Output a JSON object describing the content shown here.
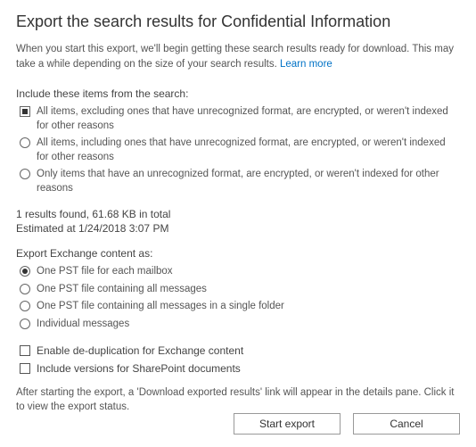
{
  "title": "Export the search results for Confidential Information",
  "intro_text": "When you start this export, we'll begin getting these search results ready for download. This may take a while depending on the size of your search results. ",
  "learn_more": "Learn more",
  "include_section": {
    "label": "Include these items from the search:",
    "options": [
      {
        "label": "All items, excluding ones that have unrecognized format, are encrypted, or weren't indexed for other reasons",
        "selected": true
      },
      {
        "label": "All items, including ones that have unrecognized format, are encrypted, or weren't indexed for other reasons",
        "selected": false
      },
      {
        "label": "Only items that have an unrecognized format, are encrypted, or weren't indexed for other reasons",
        "selected": false
      }
    ]
  },
  "stats": {
    "line1": "1 results found, 61.68 KB in total",
    "line2": "Estimated at 1/24/2018 3:07 PM"
  },
  "export_section": {
    "label": "Export Exchange content as:",
    "options": [
      {
        "label": "One PST file for each mailbox",
        "selected": true
      },
      {
        "label": "One PST file containing all messages",
        "selected": false
      },
      {
        "label": "One PST file containing all messages in a single folder",
        "selected": false
      },
      {
        "label": "Individual messages",
        "selected": false
      }
    ]
  },
  "checkboxes": {
    "dedup": {
      "label": "Enable de-duplication for Exchange content",
      "checked": false
    },
    "versions": {
      "label": "Include versions for SharePoint documents",
      "checked": false
    }
  },
  "footer_note": "After starting the export, a 'Download exported results' link will appear in the details pane. Click it to view the export status.",
  "buttons": {
    "start": "Start export",
    "cancel": "Cancel"
  }
}
